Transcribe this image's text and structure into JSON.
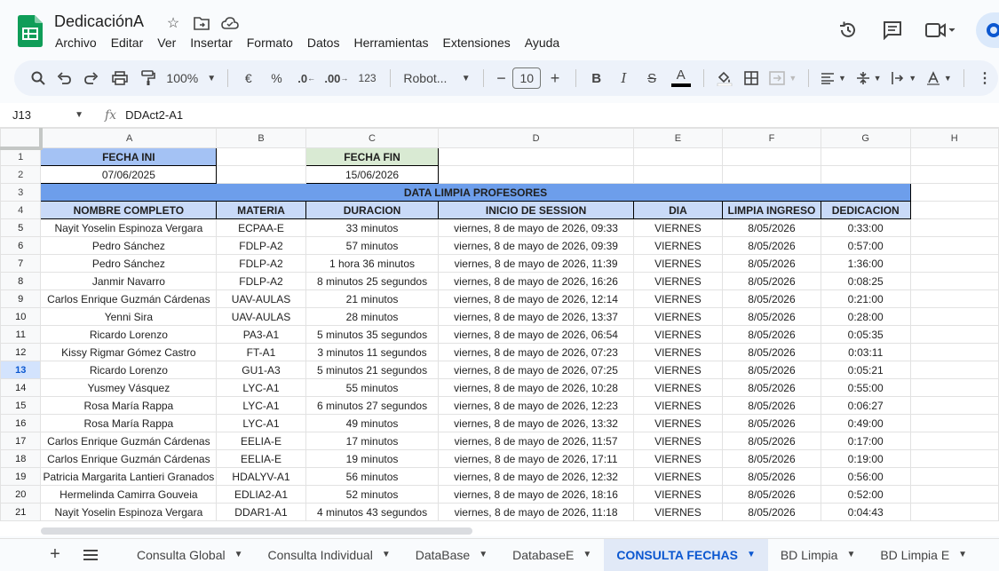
{
  "app": {
    "doc_title": "DedicaciónA",
    "menus": [
      "Archivo",
      "Editar",
      "Ver",
      "Insertar",
      "Formato",
      "Datos",
      "Herramientas",
      "Extensiones",
      "Ayuda"
    ],
    "accent": "#0b57d0",
    "logo_color": "#0f9d58"
  },
  "toolbar": {
    "zoom": "100%",
    "currency": "€",
    "percent": "%",
    "dec_decrease": ".0",
    "dec_increase": ".00",
    "number_format": "123",
    "font": "Robot...",
    "font_size": "10",
    "bold": "B",
    "italic": "I",
    "strike": "S",
    "text_color": "A"
  },
  "formula_bar": {
    "cell_ref": "J13",
    "fx": "fx",
    "value": "DDAct2-A1"
  },
  "columns": [
    "A",
    "B",
    "C",
    "D",
    "E",
    "F",
    "G",
    "H"
  ],
  "rows": {
    "r1": {
      "num": "1",
      "a": "FECHA INI",
      "c": "FECHA FIN"
    },
    "r2": {
      "num": "2",
      "a": "07/06/2025",
      "c": "15/06/2026"
    },
    "r3": {
      "num": "3",
      "banner": "DATA LIMPIA PROFESORES"
    },
    "r4": {
      "num": "4",
      "headers": [
        "NOMBRE COMPLETO",
        "MATERIA",
        "DURACION",
        "INICIO DE SESSION",
        "DIA",
        "LIMPIA INGRESO",
        "DEDICACION"
      ]
    }
  },
  "data_rows": [
    {
      "num": "5",
      "cells": [
        "Nayit Yoselin Espinoza Vergara",
        "ECPAA-E",
        "33 minutos",
        "viernes, 8 de mayo de 2026, 09:33",
        "VIERNES",
        "8/05/2026",
        "0:33:00"
      ]
    },
    {
      "num": "6",
      "cells": [
        "Pedro Sánchez",
        "FDLP-A2",
        "57 minutos",
        "viernes, 8 de mayo de 2026, 09:39",
        "VIERNES",
        "8/05/2026",
        "0:57:00"
      ]
    },
    {
      "num": "7",
      "cells": [
        "Pedro Sánchez",
        "FDLP-A2",
        "1 hora 36 minutos",
        "viernes, 8 de mayo de 2026, 11:39",
        "VIERNES",
        "8/05/2026",
        "1:36:00"
      ]
    },
    {
      "num": "8",
      "cells": [
        "Janmir Navarro",
        "FDLP-A2",
        "8 minutos 25 segundos",
        "viernes, 8 de mayo de 2026, 16:26",
        "VIERNES",
        "8/05/2026",
        "0:08:25"
      ]
    },
    {
      "num": "9",
      "cells": [
        "Carlos Enrique Guzmán Cárdenas",
        "UAV-AULAS",
        "21 minutos",
        "viernes, 8 de mayo de 2026, 12:14",
        "VIERNES",
        "8/05/2026",
        "0:21:00"
      ]
    },
    {
      "num": "10",
      "cells": [
        "Yenni Sira",
        "UAV-AULAS",
        "28 minutos",
        "viernes, 8 de mayo de 2026, 13:37",
        "VIERNES",
        "8/05/2026",
        "0:28:00"
      ]
    },
    {
      "num": "11",
      "cells": [
        "Ricardo Lorenzo",
        "PA3-A1",
        "5 minutos 35 segundos",
        "viernes, 8 de mayo de 2026, 06:54",
        "VIERNES",
        "8/05/2026",
        "0:05:35"
      ]
    },
    {
      "num": "12",
      "cells": [
        "Kissy Rigmar Gómez Castro",
        "FT-A1",
        "3 minutos 11 segundos",
        "viernes, 8 de mayo de 2026, 07:23",
        "VIERNES",
        "8/05/2026",
        "0:03:11"
      ]
    },
    {
      "num": "13",
      "cells": [
        "Ricardo Lorenzo",
        "GU1-A3",
        "5 minutos 21 segundos",
        "viernes, 8 de mayo de 2026, 07:25",
        "VIERNES",
        "8/05/2026",
        "0:05:21"
      ]
    },
    {
      "num": "14",
      "cells": [
        "Yusmey Vásquez",
        "LYC-A1",
        "55 minutos",
        "viernes, 8 de mayo de 2026, 10:28",
        "VIERNES",
        "8/05/2026",
        "0:55:00"
      ]
    },
    {
      "num": "15",
      "cells": [
        "Rosa María Rappa",
        "LYC-A1",
        "6 minutos 27 segundos",
        "viernes, 8 de mayo de 2026, 12:23",
        "VIERNES",
        "8/05/2026",
        "0:06:27"
      ]
    },
    {
      "num": "16",
      "cells": [
        "Rosa María Rappa",
        "LYC-A1",
        "49 minutos",
        "viernes, 8 de mayo de 2026, 13:32",
        "VIERNES",
        "8/05/2026",
        "0:49:00"
      ]
    },
    {
      "num": "17",
      "cells": [
        "Carlos Enrique Guzmán Cárdenas",
        "EELIA-E",
        "17 minutos",
        "viernes, 8 de mayo de 2026, 11:57",
        "VIERNES",
        "8/05/2026",
        "0:17:00"
      ]
    },
    {
      "num": "18",
      "cells": [
        "Carlos Enrique Guzmán Cárdenas",
        "EELIA-E",
        "19 minutos",
        "viernes, 8 de mayo de 2026, 17:11",
        "VIERNES",
        "8/05/2026",
        "0:19:00"
      ]
    },
    {
      "num": "19",
      "cells": [
        "Patricia Margarita Lantieri Granados",
        "HDALYV-A1",
        "56 minutos",
        "viernes, 8 de mayo de 2026, 12:32",
        "VIERNES",
        "8/05/2026",
        "0:56:00"
      ]
    },
    {
      "num": "20",
      "cells": [
        "Hermelinda Camirra Gouveia",
        "EDLIA2-A1",
        "52 minutos",
        "viernes, 8 de mayo de 2026, 18:16",
        "VIERNES",
        "8/05/2026",
        "0:52:00"
      ]
    },
    {
      "num": "21",
      "cells": [
        "Nayit Yoselin Espinoza Vergara",
        "DDAR1-A1",
        "4 minutos 43 segundos",
        "viernes, 8 de mayo de 2026, 11:18",
        "VIERNES",
        "8/05/2026",
        "0:04:43"
      ]
    }
  ],
  "selected_row": "13",
  "sheets": [
    {
      "label": "Consulta Global",
      "active": false
    },
    {
      "label": "Consulta Individual",
      "active": false
    },
    {
      "label": "DataBase",
      "active": false
    },
    {
      "label": "DatabaseE",
      "active": false
    },
    {
      "label": "CONSULTA FECHAS",
      "active": true
    },
    {
      "label": "BD Limpia",
      "active": false
    },
    {
      "label": "BD Limpia E",
      "active": false
    }
  ]
}
